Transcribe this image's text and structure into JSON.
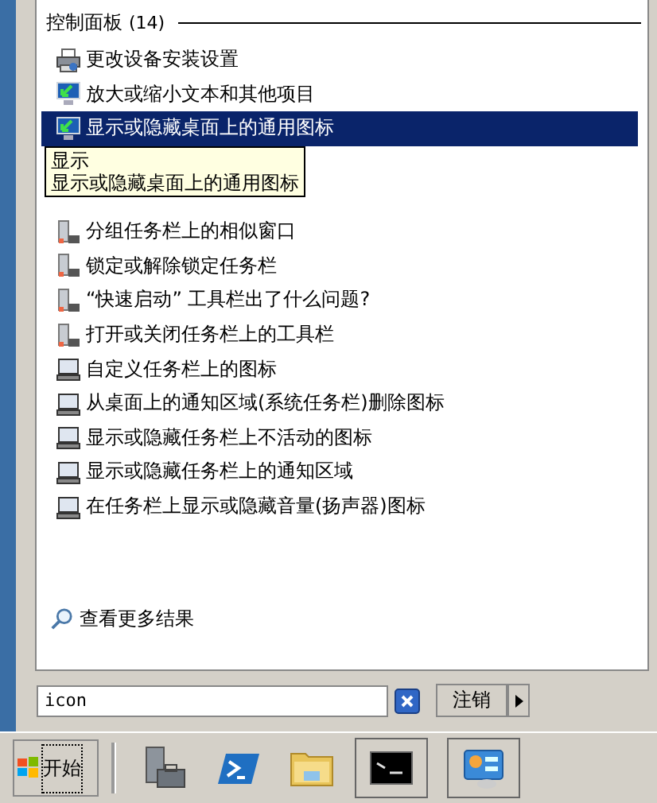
{
  "results": {
    "group_title": "控制面板",
    "group_count": "(14)",
    "items": [
      {
        "label": "更改设备安装设置",
        "kind": "printer",
        "selected": false
      },
      {
        "label": "放大或缩小文本和其他项目",
        "kind": "display",
        "selected": false
      },
      {
        "label": "显示或隐藏桌面上的通用图标",
        "kind": "display",
        "selected": true
      },
      {
        "label": "分组任务栏上的相似窗口",
        "kind": "tower",
        "selected": false
      },
      {
        "label": "锁定或解除锁定任务栏",
        "kind": "tower",
        "selected": false
      },
      {
        "label": "“快速启动” 工具栏出了什么问题?",
        "kind": "tower",
        "selected": false
      },
      {
        "label": "打开或关闭任务栏上的工具栏",
        "kind": "tower",
        "selected": false
      },
      {
        "label": "自定义任务栏上的图标",
        "kind": "laptop",
        "selected": false
      },
      {
        "label": "从桌面上的通知区域(系统任务栏)删除图标",
        "kind": "laptop",
        "selected": false
      },
      {
        "label": "显示或隐藏任务栏上不活动的图标",
        "kind": "laptop",
        "selected": false
      },
      {
        "label": "显示或隐藏任务栏上的通知区域",
        "kind": "laptop",
        "selected": false
      },
      {
        "label": "在任务栏上显示或隐藏音量(扬声器)图标",
        "kind": "laptop",
        "selected": false
      }
    ],
    "tooltip": {
      "title": "显示",
      "text": "显示或隐藏桌面上的通用图标"
    },
    "more_results": "查看更多结果"
  },
  "search": {
    "value": "icon"
  },
  "logoff_button": "注销",
  "start_button": "开始",
  "taskbar": [
    {
      "kind": "server"
    },
    {
      "kind": "powershell"
    },
    {
      "kind": "folder"
    },
    {
      "kind": "console"
    },
    {
      "kind": "panel"
    }
  ]
}
